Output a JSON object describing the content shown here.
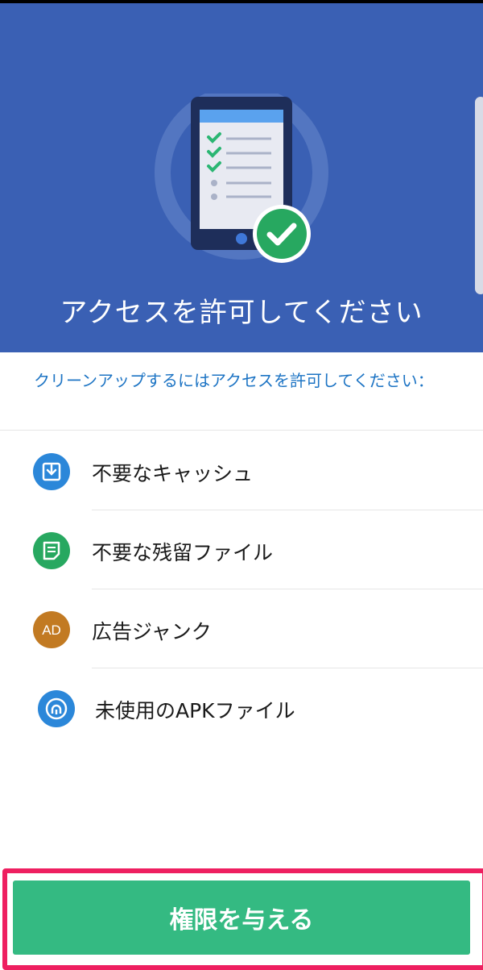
{
  "hero": {
    "title": "アクセスを許可してください",
    "background_color": "#3a60b4"
  },
  "subtitle": "クリーンアップするにはアクセスを許可してください：",
  "items": [
    {
      "label": "不要なキャッシュ",
      "icon": "download-box-icon",
      "icon_color": "#2b87d9"
    },
    {
      "label": "不要な残留ファイル",
      "icon": "document-icon",
      "icon_color": "#27a860"
    },
    {
      "label": "広告ジャンク",
      "icon": "ad-icon",
      "icon_text": "AD",
      "icon_color": "#c27a22"
    },
    {
      "label": "未使用のAPKファイル",
      "icon": "apk-icon",
      "icon_color": "#2b87d9"
    }
  ],
  "grant_button": {
    "label": "権限を与える",
    "color": "#34ba82",
    "highlight_color": "#ee1f60"
  }
}
